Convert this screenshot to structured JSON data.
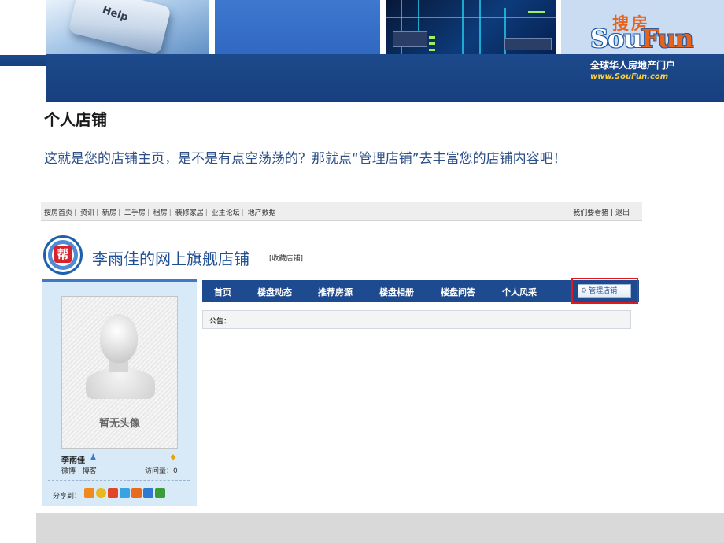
{
  "logo": {
    "brand_cn": "搜房",
    "brand_en_prefix": "Sou",
    "brand_en_suffix": "Fun",
    "tagline": "全球华人房地产门户",
    "url": "www.SouFun.com"
  },
  "banner": {
    "keyboard_key": "Help"
  },
  "slide": {
    "title": "个人店铺",
    "description": "这就是您的店铺主页，是不是有点空荡荡的？那就点“管理店铺”去丰富您的店铺内容吧！"
  },
  "top_nav": {
    "links": [
      "搜房首页",
      "资讯",
      "新房",
      "二手房",
      "租房",
      "装修家居",
      "业主论坛",
      "地产数据"
    ],
    "right": "我们要看猪 | 退出"
  },
  "shop": {
    "logo_char": "帮",
    "title": "李雨佳的网上旗舰店铺",
    "favorite": "[收藏店铺]"
  },
  "main_nav": {
    "tabs": [
      "首页",
      "楼盘动态",
      "推荐房源",
      "楼盘相册",
      "楼盘问答",
      "个人风采"
    ],
    "manage": "管理店铺"
  },
  "notice": {
    "label": "公告："
  },
  "profile": {
    "no_avatar": "暂无头像",
    "name": "李雨佳",
    "links": "微博 | 博客",
    "visits": "访问量：0",
    "share_label": "分享到："
  },
  "colors": {
    "banner_band": "#1d4a8c",
    "nav_bar": "#1e4b8f",
    "highlight": "#e0191f",
    "sidebar_bg": "#d8e9f8",
    "text_blue": "#2b4f86"
  }
}
